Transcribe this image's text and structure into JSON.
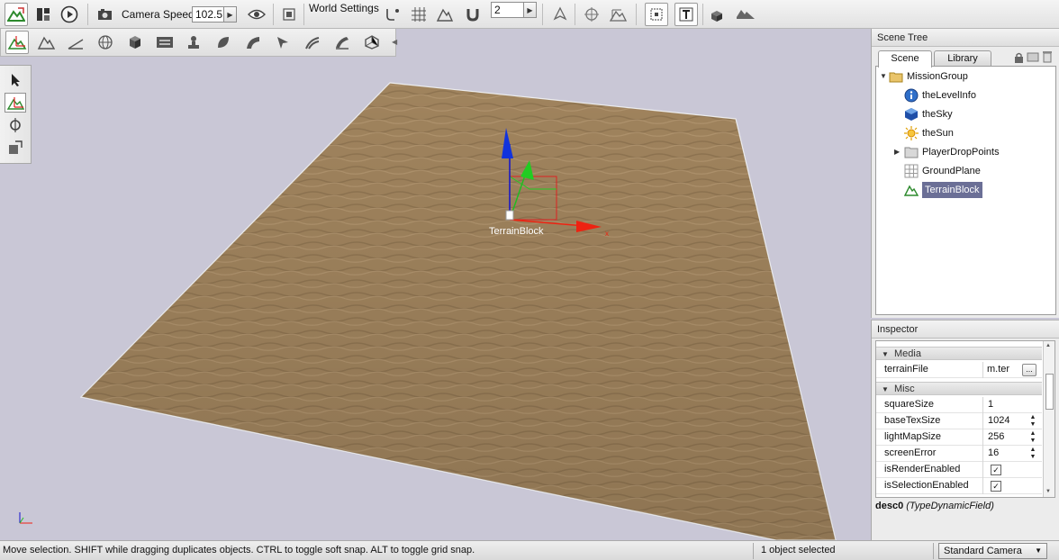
{
  "toolbar": {
    "camera_speed_label": "Camera Speed",
    "camera_speed_value": "102.5",
    "world_settings_label": "World Settings",
    "snap_value": "2",
    "spin_arrow": "▶"
  },
  "viewport": {
    "object_label": "TerrainBlock",
    "axis_x_label": "x",
    "terrain_color": "#a88a62"
  },
  "scene_tree": {
    "title": "Scene Tree",
    "tabs": [
      "Scene",
      "Library"
    ],
    "items": [
      {
        "label": "MissionGroup",
        "icon": "folder-open-icon"
      },
      {
        "label": "theLevelInfo",
        "icon": "info-icon"
      },
      {
        "label": "theSky",
        "icon": "sky-icon"
      },
      {
        "label": "theSun",
        "icon": "sun-icon"
      },
      {
        "label": "PlayerDropPoints",
        "icon": "folder-icon"
      },
      {
        "label": "GroundPlane",
        "icon": "grid-icon"
      },
      {
        "label": "TerrainBlock",
        "icon": "terrain-icon"
      }
    ]
  },
  "inspector": {
    "title": "Inspector",
    "groups": [
      {
        "name": "Media",
        "props": [
          {
            "name": "terrainFile",
            "value": "m.ter",
            "button": "..."
          }
        ]
      },
      {
        "name": "Misc",
        "props": [
          {
            "name": "squareSize",
            "value": "1"
          },
          {
            "name": "baseTexSize",
            "value": "1024"
          },
          {
            "name": "lightMapSize",
            "value": "256"
          },
          {
            "name": "screenError",
            "value": "16"
          },
          {
            "name": "isRenderEnabled",
            "value": "✓"
          },
          {
            "name": "isSelectionEnabled",
            "value": "✓"
          }
        ]
      }
    ],
    "desc_name": "desc0",
    "desc_type": "(TypeDynamicField)"
  },
  "status": {
    "hint": "Move selection.  SHIFT while dragging duplicates objects.  CTRL to toggle soft snap.  ALT to toggle grid snap.",
    "selection": "1 object selected",
    "camera": "Standard Camera"
  },
  "colors": {
    "viewport_bg": "#c9c7d6",
    "selection": "#6b6f96"
  }
}
